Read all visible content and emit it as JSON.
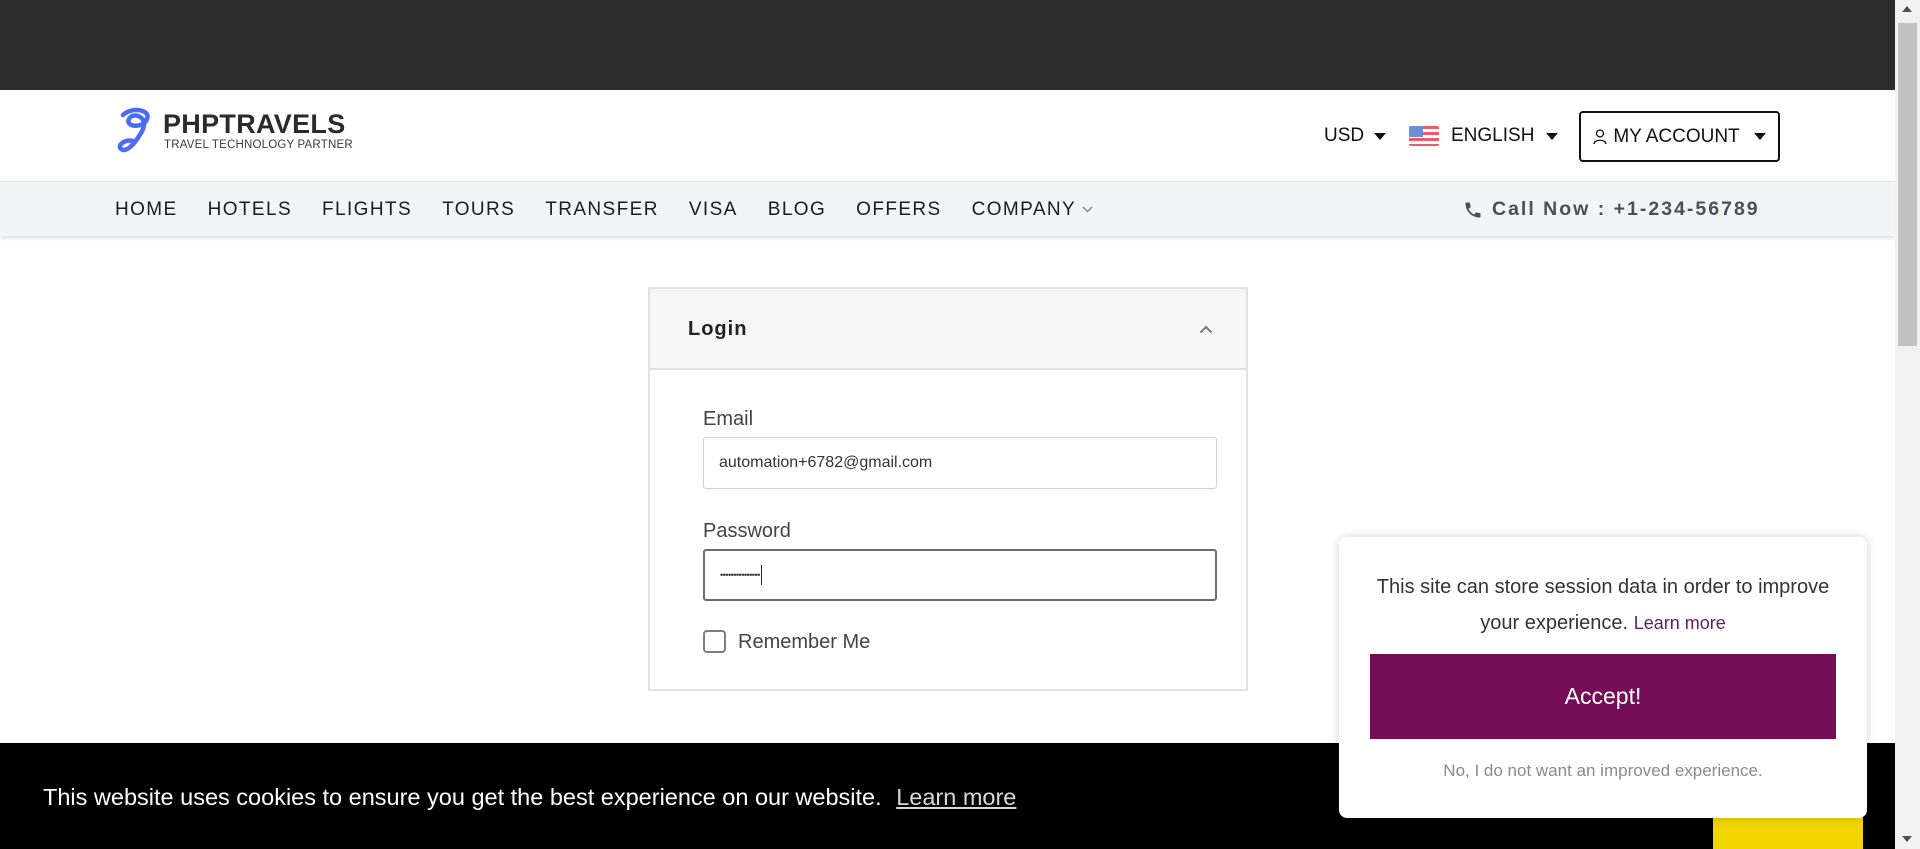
{
  "header": {
    "logo_title": "PHPTRAVELS",
    "logo_subtitle": "TRAVEL TECHNOLOGY PARTNER",
    "currency": "USD",
    "language": "ENGLISH",
    "account_label": "MY ACCOUNT"
  },
  "nav": {
    "items": [
      "HOME",
      "HOTELS",
      "FLIGHTS",
      "TOURS",
      "TRANSFER",
      "VISA",
      "BLOG",
      "OFFERS",
      "COMPANY"
    ],
    "call_label": "Call Now : +1-234-56789"
  },
  "login": {
    "title": "Login",
    "email_label": "Email",
    "email_value": "automation+6782@gmail.com",
    "password_label": "Password",
    "password_value": "•••••••••••••••",
    "remember_label": "Remember Me",
    "remember_checked": false
  },
  "cookie_bar": {
    "text": "This website uses cookies to ensure you get the best experience on our website.",
    "learn_more": "Learn more"
  },
  "consent": {
    "text": "This site can store session data in order to improve your experience.",
    "learn_more": "Learn more",
    "accept_label": "Accept!",
    "decline_label": "No, I do not want an improved experience."
  },
  "colors": {
    "topbar": "#2c2c2c",
    "accept_button": "#740d55",
    "cookie_accent": "#f1d600"
  }
}
